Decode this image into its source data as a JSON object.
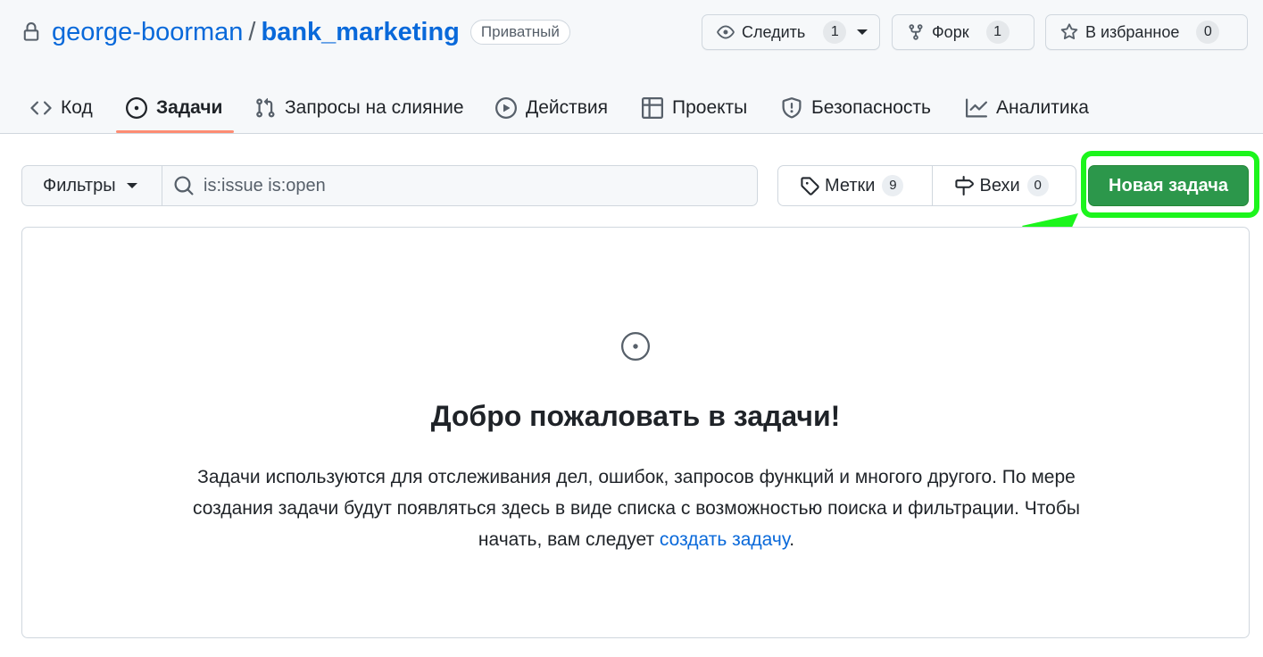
{
  "repo": {
    "owner": "george-boorman",
    "separator": "/",
    "name": "bank_marketing",
    "visibility": "Приватный"
  },
  "actions": {
    "watch": {
      "label": "Следить",
      "count": "1"
    },
    "fork": {
      "label": "Форк",
      "count": "1"
    },
    "star": {
      "label": "В избранное",
      "count": "0"
    }
  },
  "nav": {
    "items": [
      {
        "label": "Код",
        "icon": "code-icon"
      },
      {
        "label": "Задачи",
        "icon": "issue-icon",
        "selected": true
      },
      {
        "label": "Запросы на слияние",
        "icon": "pull-request-icon"
      },
      {
        "label": "Действия",
        "icon": "play-icon"
      },
      {
        "label": "Проекты",
        "icon": "table-icon"
      },
      {
        "label": "Безопасность",
        "icon": "shield-icon"
      },
      {
        "label": "Аналитика",
        "icon": "graph-icon"
      }
    ]
  },
  "toolbar": {
    "filters_label": "Фильтры",
    "search_value": "is:issue is:open",
    "labels_label": "Метки",
    "labels_count": "9",
    "milestones_label": "Вехи",
    "milestones_count": "0",
    "new_issue_label": "Новая задача"
  },
  "blankslate": {
    "title": "Добро пожаловать в задачи!",
    "description_before": "Задачи используются для отслеживания дел, ошибок, запросов функций и многого другого. По мере создания задачи будут появляться здесь в виде списка с возможностью поиска и фильтрации. Чтобы начать, вам следует ",
    "link_text": "создать задачу",
    "description_after": "."
  },
  "colors": {
    "link": "#0969da",
    "primary_button": "#2c974b",
    "highlight": "#1cf51c",
    "tab_underline": "#fd8c73"
  }
}
